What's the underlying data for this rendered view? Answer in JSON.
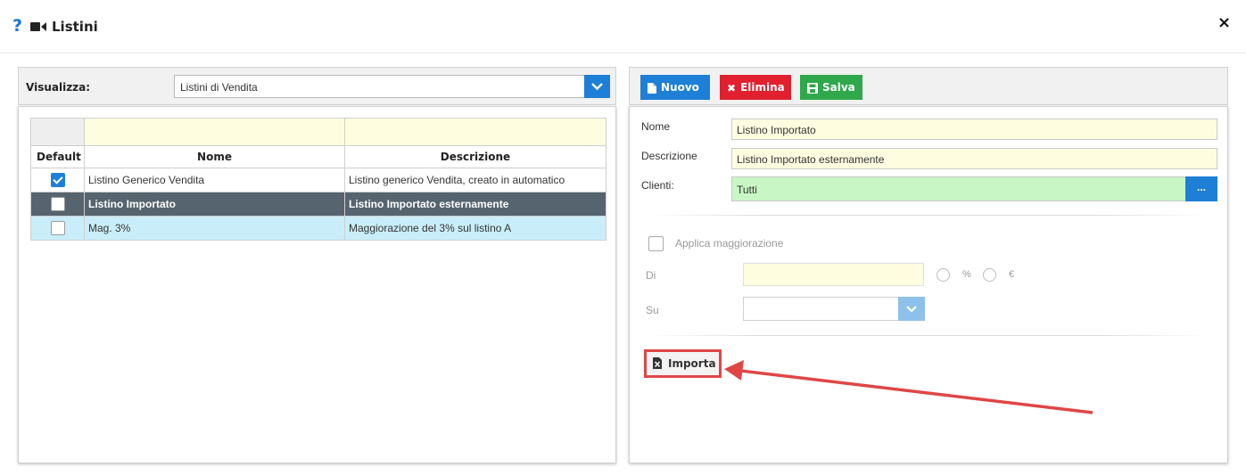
{
  "window": {
    "title": "Listini",
    "help_icon_text": "?",
    "close_text": "×"
  },
  "left": {
    "view_label": "Visualizza:",
    "view_select_value": "Listini di Vendita",
    "table": {
      "columns": [
        "Default",
        "Nome",
        "Descrizione"
      ],
      "rows": [
        {
          "default": true,
          "nome": "Listino Generico Vendita",
          "descrizione": "Listino generico Vendita, creato in automatico"
        },
        {
          "default": false,
          "nome": "Listino Importato",
          "descrizione": "Listino Importato esternamente"
        },
        {
          "default": false,
          "nome": "Mag. 3%",
          "descrizione": "Maggiorazione del 3% sul listino A"
        }
      ]
    }
  },
  "toolbar": {
    "new_label": "Nuovo",
    "delete_label": "Elimina",
    "save_label": "Salva"
  },
  "form": {
    "nome_label": "Nome",
    "nome_value": "Listino Importato",
    "descrizione_label": "Descrizione",
    "descrizione_value": "Listino Importato esternamente",
    "clienti_label": "Clienti:",
    "clienti_value": "Tutti",
    "clienti_button": "...",
    "applica_label": "Applica maggiorazione",
    "di_label": "Di",
    "percent_label": "%",
    "euro_label": "€",
    "su_label": "Su",
    "importa_label": "Importa"
  },
  "colors": {
    "accent_blue": "#1e7fd6",
    "danger_red": "#e0202f",
    "success_green": "#2ea84a",
    "selected_row": "#55646e",
    "highlight_row": "#c9eef9",
    "annotation_red": "#e04646"
  }
}
